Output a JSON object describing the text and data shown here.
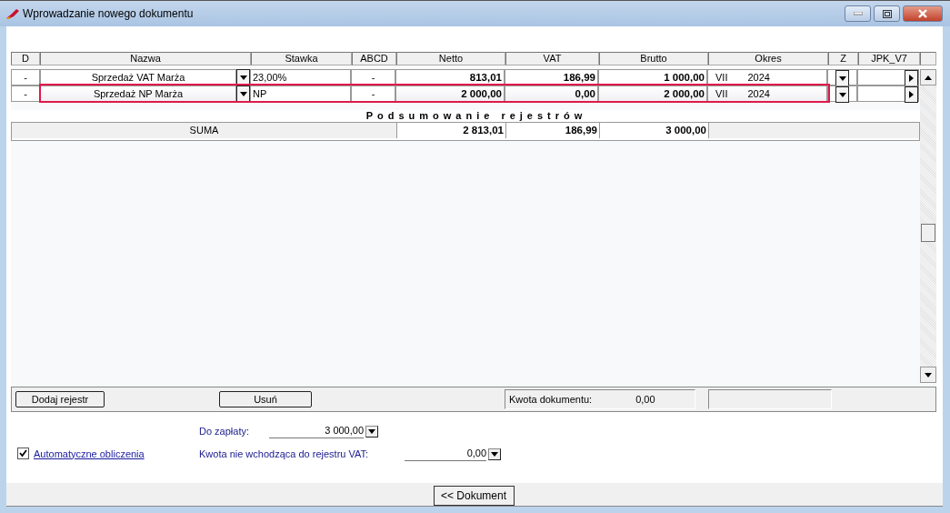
{
  "window": {
    "title": "Wprowadzanie nowego dokumentu"
  },
  "table": {
    "columns": [
      "D",
      "Nazwa",
      "Stawka",
      "ABCD",
      "Netto",
      "VAT",
      "Brutto",
      "Okres",
      "Z",
      "JPK_V7"
    ],
    "rows": [
      {
        "d": "-",
        "name": "Sprzedaż VAT Marża",
        "rate": "23,00%",
        "abcd": "-",
        "netto": "813,01",
        "vat": "186,99",
        "brutto": "1 000,00",
        "month": "VII",
        "year": "2024",
        "selected": false
      },
      {
        "d": "-",
        "name": "Sprzedaż NP Marża",
        "rate": "NP",
        "abcd": "-",
        "netto": "2 000,00",
        "vat": "0,00",
        "brutto": "2 000,00",
        "month": "VII",
        "year": "2024",
        "selected": true
      }
    ]
  },
  "summary": {
    "title": "Podsumowanie rejestrów",
    "label": "SUMA",
    "netto": "2 813,01",
    "vat": "186,99",
    "brutto": "3 000,00"
  },
  "toolbar": {
    "add_button": "Dodaj rejestr",
    "delete_button": "Usuń",
    "amount_label": "Kwota dokumentu:",
    "amount_value": "0,00"
  },
  "form": {
    "auto_calc": {
      "label": "Automatyczne obliczenia",
      "checked": true
    },
    "to_pay": {
      "label": "Do zapłaty:",
      "value": "3 000,00"
    },
    "non_vat": {
      "label": "Kwota nie wchodząca do rejestru VAT:",
      "value": "0,00"
    }
  },
  "footer_button": "<< Dokument"
}
